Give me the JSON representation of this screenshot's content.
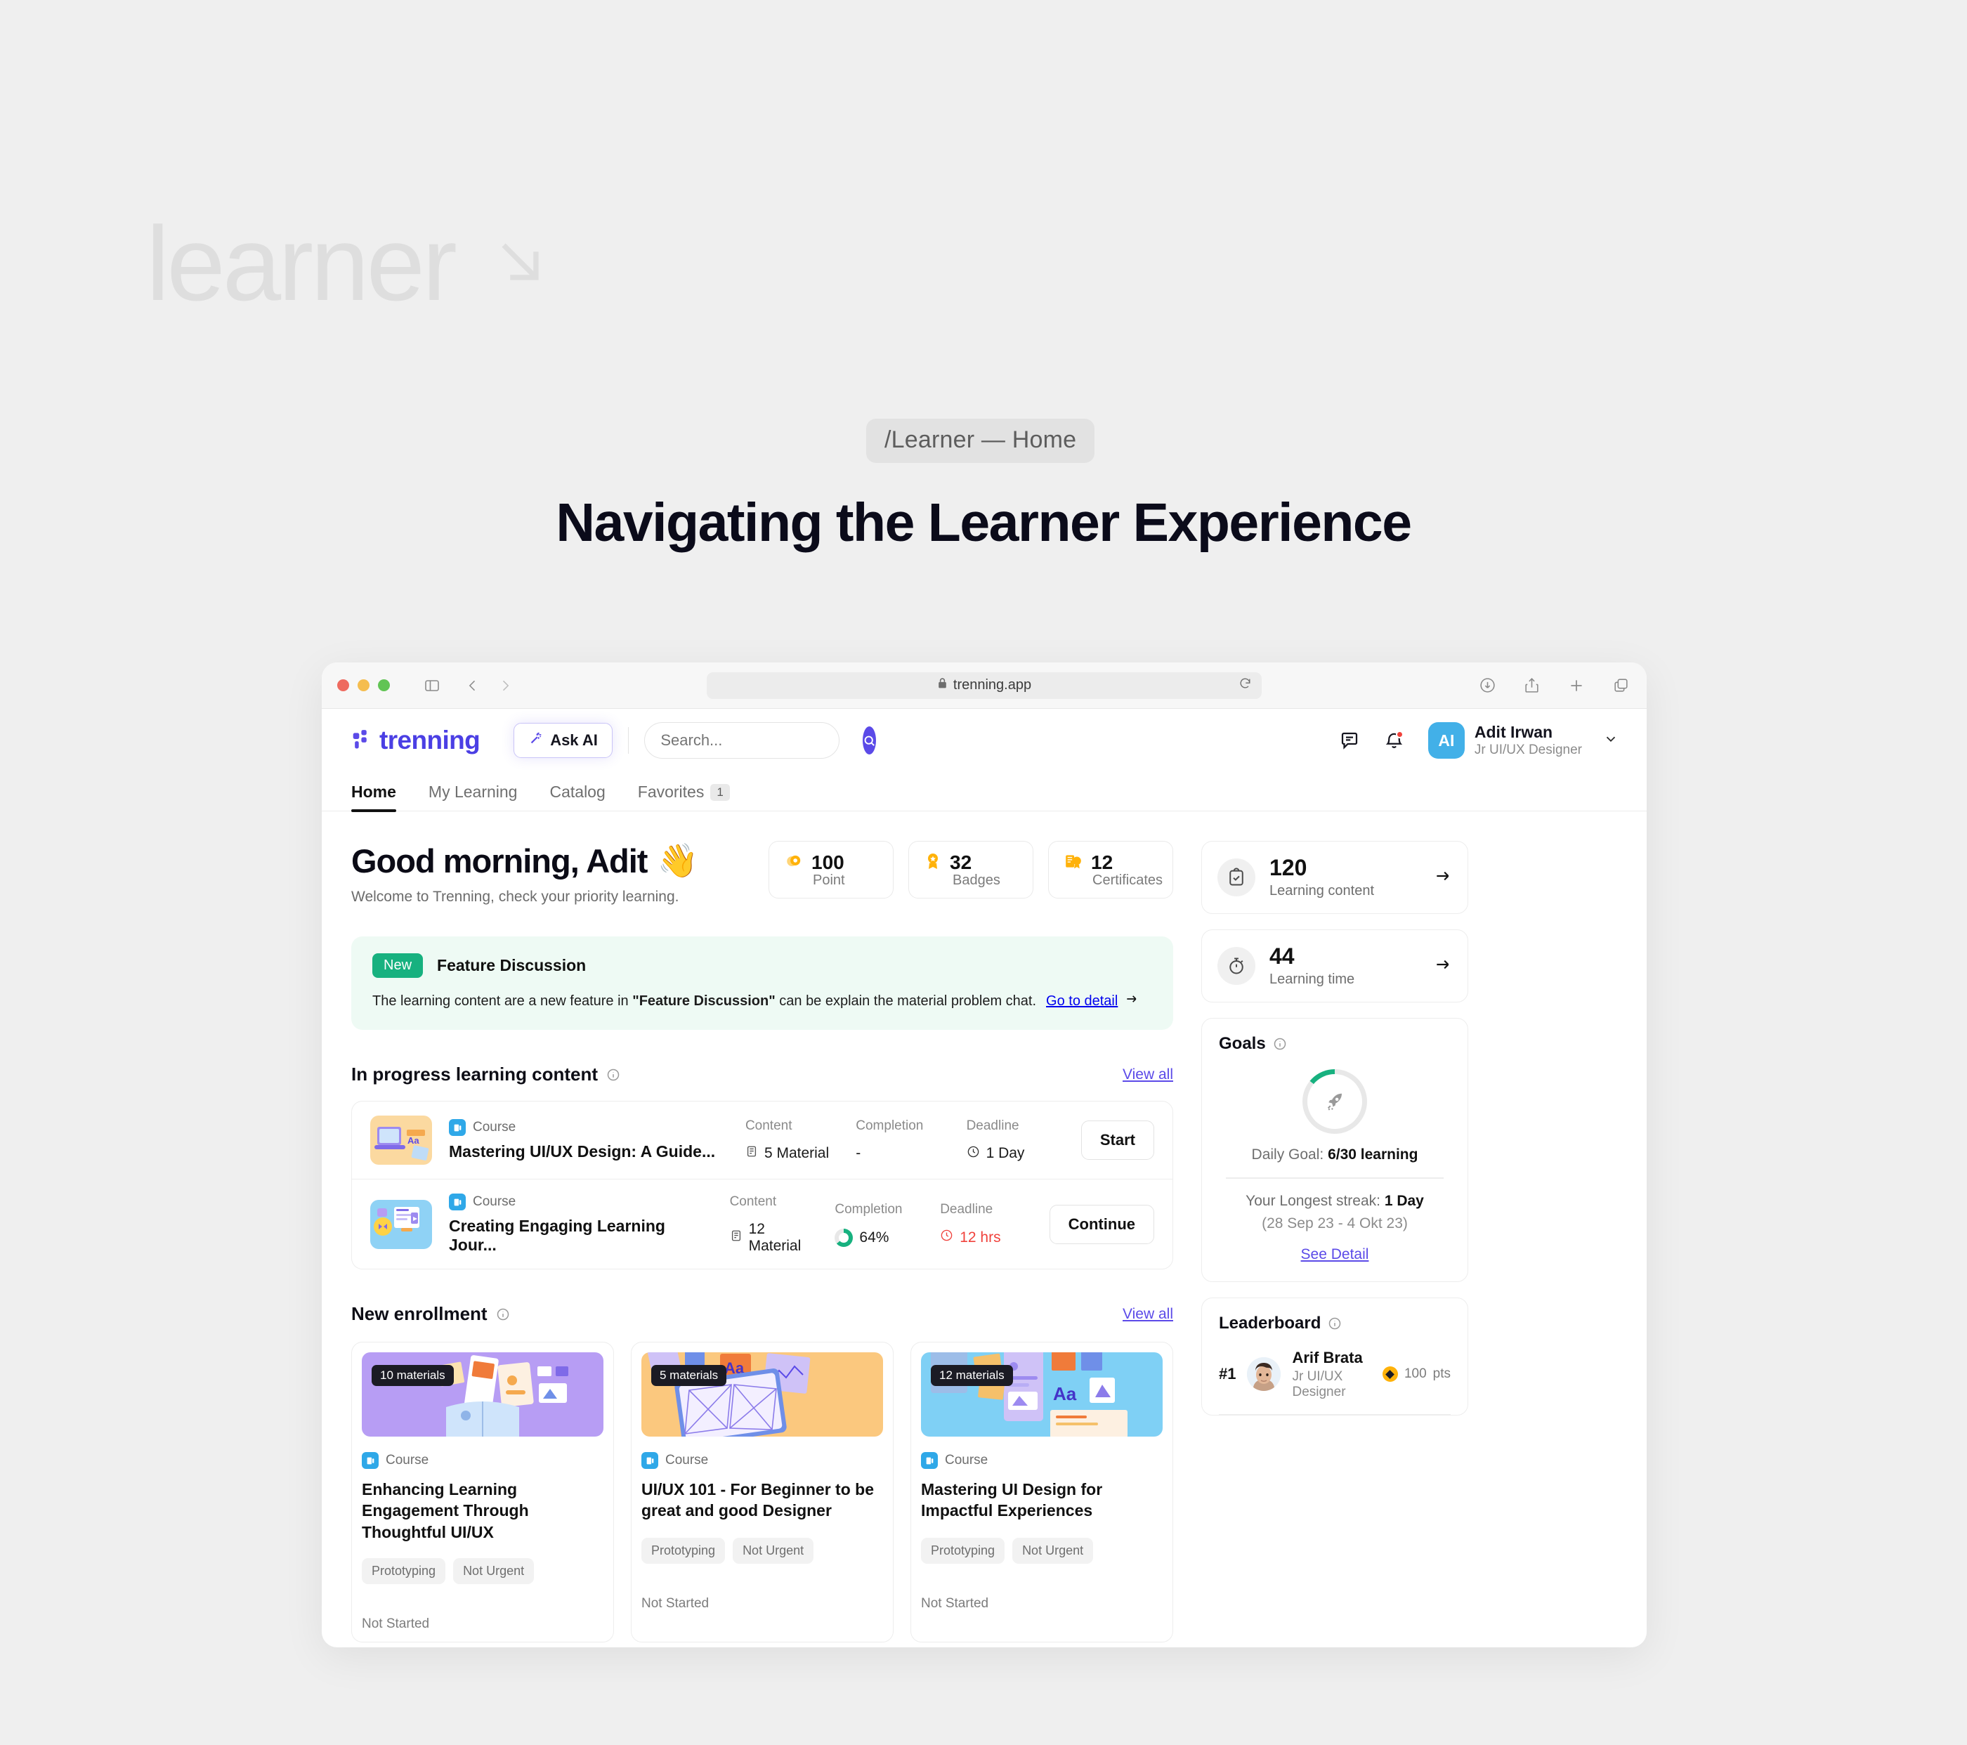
{
  "watermark": {
    "text": "learner",
    "arrow_icon": "arrow-down-right-icon"
  },
  "breadcrumb": "/Learner — Home",
  "headline": "Navigating the Learner Experience",
  "browser": {
    "url": "trenning.app",
    "lock_icon": "lock-icon",
    "sidebar_icon": "sidebar-toggle-icon",
    "back_icon": "chevron-left-icon",
    "forward_icon": "chevron-right-icon",
    "shield_icon": "shield-icon",
    "reload_icon": "reload-icon",
    "download_icon": "download-icon",
    "share_icon": "share-icon",
    "new_tab_icon": "plus-icon",
    "tabs_icon": "copy-tabs-icon"
  },
  "app_header": {
    "logo_text": "trenning",
    "ask_ai_label": "Ask AI",
    "ask_ai_icon": "magic-wand-icon",
    "search_placeholder": "Search...",
    "search_icon": "search-icon",
    "chat_icon": "chat-icon",
    "bell_icon": "bell-icon",
    "avatar_initials": "AI",
    "user_name": "Adit Irwan",
    "user_role": "Jr UI/UX Designer",
    "chevron_icon": "chevron-down-icon"
  },
  "tabs": [
    {
      "label": "Home",
      "active": true,
      "count": null
    },
    {
      "label": "My Learning",
      "active": false,
      "count": null
    },
    {
      "label": "Catalog",
      "active": false,
      "count": null
    },
    {
      "label": "Favorites",
      "active": false,
      "count": "1"
    }
  ],
  "greeting": {
    "title": "Good morning, Adit",
    "emoji": "👋",
    "subtitle": "Welcome to Trenning, check your priority learning."
  },
  "stats": [
    {
      "value": "100",
      "label": "Point",
      "icon": "point-coin-icon"
    },
    {
      "value": "32",
      "label": "Badges",
      "icon": "badge-medal-icon"
    },
    {
      "value": "12",
      "label": "Certificates",
      "icon": "certificate-icon"
    }
  ],
  "banner": {
    "pill": "New",
    "title": "Feature Discussion",
    "text_before": "The learning content are a new feature in ",
    "text_quoted": "\"Feature Discussion\"",
    "text_after": " can be explain the material problem chat.",
    "cta": "Go to detail",
    "cta_icon": "arrow-right-icon",
    "accent_bg": "#eefaf4",
    "pill_color": "#17b17f"
  },
  "in_progress": {
    "title": "In progress learning content",
    "info_icon": "info-icon",
    "view_all": "View all",
    "columns": {
      "content": "Content",
      "completion": "Completion",
      "deadline": "Deadline"
    },
    "rows": [
      {
        "kind": "Course",
        "kind_icon": "course-icon",
        "name": "Mastering UI/UX Design: A Guide...",
        "content": "5 Material",
        "content_icon": "material-icon",
        "completion": "-",
        "completion_pct": null,
        "deadline": "1 Day",
        "deadline_icon": "clock-icon",
        "deadline_urgent": false,
        "action": "Start",
        "thumb_bg": "#fbd9a0"
      },
      {
        "kind": "Course",
        "kind_icon": "course-icon",
        "name": "Creating Engaging Learning Jour...",
        "content": "12 Material",
        "content_icon": "material-icon",
        "completion": "64%",
        "completion_pct": 64,
        "deadline": "12 hrs",
        "deadline_icon": "clock-icon",
        "deadline_urgent": true,
        "action": "Continue",
        "thumb_bg": "#8fd2f5"
      }
    ]
  },
  "new_enrollment": {
    "title": "New enrollment",
    "info_icon": "info-icon",
    "view_all": "View all",
    "cards": [
      {
        "materials": "10 materials",
        "kind": "Course",
        "kind_icon": "course-icon",
        "title": "Enhancing Learning Engagement Through Thoughtful UI/UX",
        "chips": [
          "Prototyping",
          "Not Urgent"
        ],
        "status": "Not Started",
        "img_bg": "#b79df4"
      },
      {
        "materials": "5 materials",
        "kind": "Course",
        "kind_icon": "course-icon",
        "title": "UI/UX 101 - For Beginner to be great and good Designer",
        "chips": [
          "Prototyping",
          "Not Urgent"
        ],
        "status": "Not Started",
        "img_bg": "#fbc87e"
      },
      {
        "materials": "12 materials",
        "kind": "Course",
        "kind_icon": "course-icon",
        "title": "Mastering UI Design for Impactful Experiences",
        "chips": [
          "Prototyping",
          "Not Urgent"
        ],
        "status": "Not Started",
        "img_bg": "#7fd0f5"
      }
    ]
  },
  "side": {
    "metrics": [
      {
        "value": "120",
        "label": "Learning content",
        "icon": "clipboard-check-icon",
        "arrow_icon": "arrow-right-icon"
      },
      {
        "value": "44",
        "label": "Learning time",
        "icon": "stopwatch-icon",
        "arrow_icon": "arrow-right-icon"
      }
    ],
    "goals": {
      "title": "Goals",
      "info_icon": "info-icon",
      "gauge_icon": "rocket-icon",
      "gauge_pct": 14,
      "daily_goal_label": "Daily Goal:",
      "daily_goal_value": "6/30 learning",
      "streak_label": "Your Longest streak:",
      "streak_value": "1 Day",
      "streak_dates": "(28 Sep 23 - 4 Okt 23)",
      "see_detail": "See Detail"
    },
    "leaderboard": {
      "title": "Leaderboard",
      "info_icon": "info-icon",
      "rows": [
        {
          "rank": "#1",
          "name": "Arif Brata",
          "role": "Jr UI/UX Designer",
          "points": "100",
          "points_unit": "pts",
          "coin_icon": "coin-icon"
        }
      ]
    }
  }
}
